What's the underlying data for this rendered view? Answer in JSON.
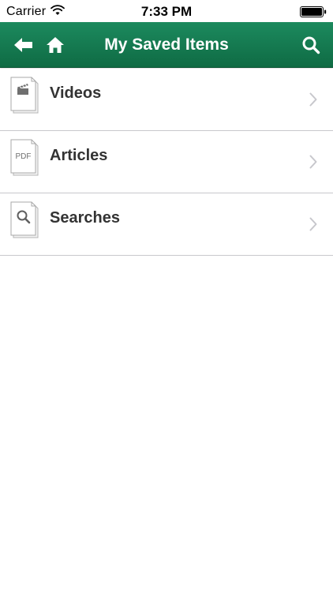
{
  "status_bar": {
    "carrier": "Carrier",
    "time": "7:33 PM",
    "wifi_icon": "wifi-icon",
    "battery_icon": "battery-icon"
  },
  "nav_bar": {
    "title": "My Saved Items",
    "background_color": "#127a50",
    "back_icon": "back-arrow-icon",
    "home_icon": "home-icon",
    "search_icon": "search-icon"
  },
  "list": {
    "items": [
      {
        "label": "Videos",
        "icon": "video-clapperboard-icon"
      },
      {
        "label": "Articles",
        "icon": "pdf-document-icon",
        "icon_text": "PDF"
      },
      {
        "label": "Searches",
        "icon": "search-document-icon"
      }
    ],
    "chevron_icon": "chevron-right-icon"
  }
}
